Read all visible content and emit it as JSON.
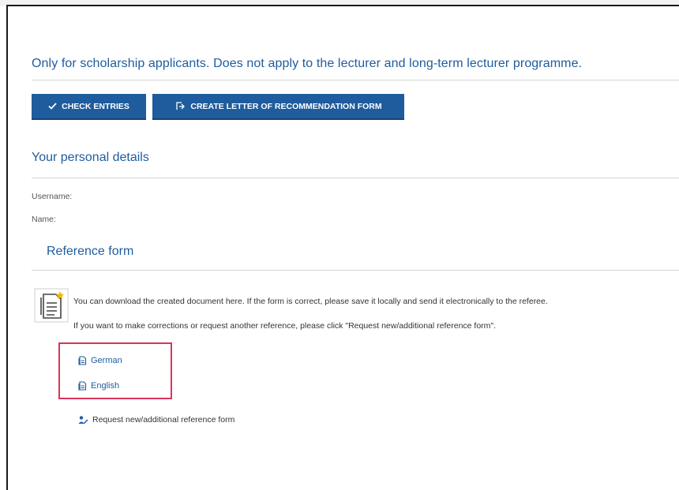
{
  "notice": "Only for scholarship applicants. Does not apply to the lecturer and long-term lecturer programme.",
  "buttons": {
    "check_entries": "CHECK ENTRIES",
    "create_form": "CREATE LETTER OF RECOMMENDATION FORM"
  },
  "personal_details": {
    "title": "Your personal details",
    "username_label": "Username:",
    "name_label": "Name:"
  },
  "reference_form": {
    "title": "Reference form",
    "info_line_1": "You can download the created document here. If the form is correct, please save it locally and send it electronically to the referee.",
    "info_line_2": "If you want to make corrections or request another reference, please click \"Request new/additional reference form\".",
    "links": [
      {
        "label": "German",
        "icon": "document-icon"
      },
      {
        "label": "English",
        "icon": "document-icon"
      }
    ],
    "request_link": "Request new/additional reference form"
  },
  "colors": {
    "primary": "#1f5c9e",
    "highlight": "#d9345a",
    "rule": "#d4d4d4"
  }
}
